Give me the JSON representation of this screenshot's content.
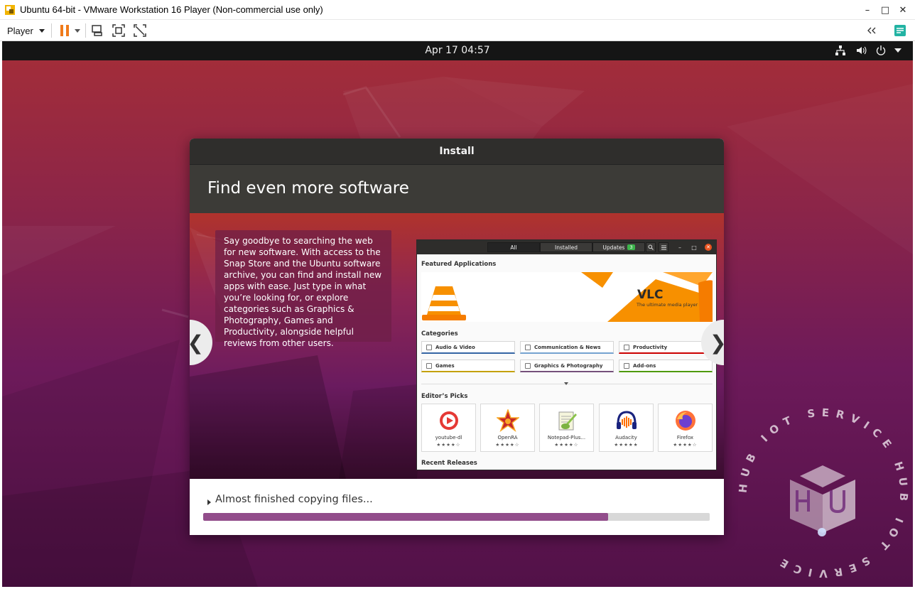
{
  "window": {
    "title": "Ubuntu 64-bit - VMware Workstation 16 Player (Non-commercial use only)",
    "controls": {
      "minimize": "–",
      "maximize": "□",
      "close": "✕"
    }
  },
  "toolbar": {
    "player_label": "Player",
    "icons": [
      "pause-icon",
      "send-ctrl-alt-del-icon",
      "fullscreen-icon",
      "unity-icon",
      "collapse-icon",
      "notes-icon"
    ]
  },
  "guest": {
    "clock": "Apr 17  04:57",
    "tray": [
      "network-icon",
      "volume-icon",
      "power-icon",
      "chevron-down-icon"
    ]
  },
  "installer": {
    "title": "Install",
    "slide_heading": "Find even more software",
    "slide_text": "Say goodbye to searching the web for new software. With access to the Snap Store and the Ubuntu software archive, you can find and install new apps with ease. Just type in what you’re looking for, or explore categories such as Graphics & Photography, Games and Productivity, alongside helpful reviews from other users.",
    "prev_arrow": "❮",
    "next_arrow": "❯",
    "progress_label": "Almost finished copying files...",
    "progress_value": 0.8
  },
  "store": {
    "tabs": {
      "all": "All",
      "installed": "Installed",
      "updates": "Updates",
      "updates_count": "3"
    },
    "featured_title": "Featured Applications",
    "banner": {
      "name": "VLC",
      "tagline": "The ultimate media player"
    },
    "categories_title": "Categories",
    "categories": [
      {
        "label": "Audio & Video",
        "color": "#3465a4"
      },
      {
        "label": "Communication & News",
        "color": "#75a3d0"
      },
      {
        "label": "Productivity",
        "color": "#cc0000"
      },
      {
        "label": "Games",
        "color": "#c4a000"
      },
      {
        "label": "Graphics & Photography",
        "color": "#75507b"
      },
      {
        "label": "Add-ons",
        "color": "#4e9a06"
      }
    ],
    "editors_title": "Editor’s Picks",
    "picks": [
      {
        "name": "youtube-dl",
        "stars": "★★★★☆"
      },
      {
        "name": "OpenRA",
        "stars": "★★★★☆"
      },
      {
        "name": "Notepad-Plus...",
        "stars": "★★★★☆"
      },
      {
        "name": "Audacity",
        "stars": "★★★★★"
      },
      {
        "name": "Firefox",
        "stars": "★★★★☆"
      }
    ],
    "recent_title": "Recent Releases"
  },
  "watermark": {
    "text": "HUB IOT SERVICE HUB IOT SERVICE"
  }
}
